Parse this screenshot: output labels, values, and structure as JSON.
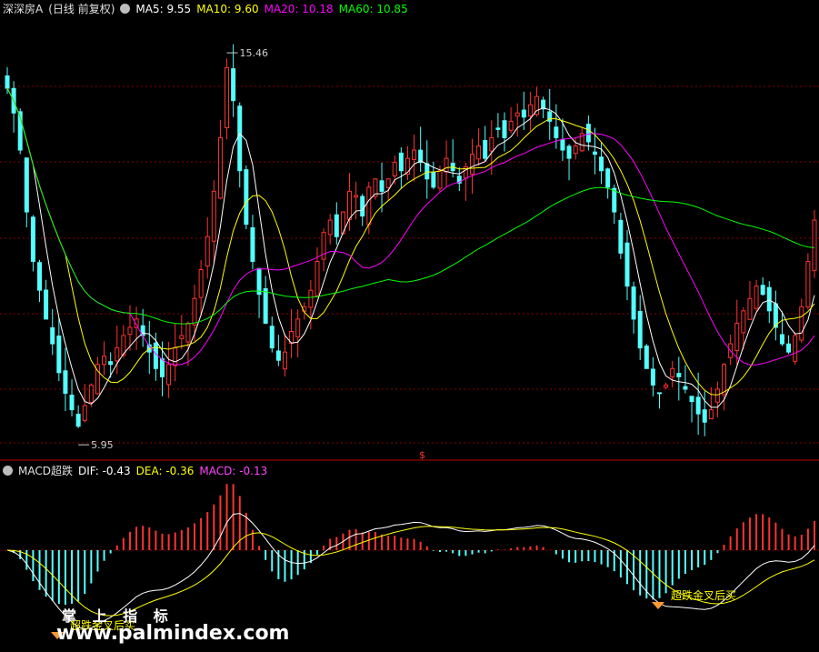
{
  "header": {
    "stock": "深深房A",
    "period": "(日线 前复权)",
    "ma": [
      {
        "label": "MA5: 9.55",
        "color": "#ffffff"
      },
      {
        "label": "MA10: 9.60",
        "color": "#ffff00"
      },
      {
        "label": "MA20: 10.18",
        "color": "#ff00ff"
      },
      {
        "label": "MA60: 10.85",
        "color": "#00ff00"
      }
    ]
  },
  "macd_header": {
    "name": "MACD超跌",
    "dif": "DIF: -0.43",
    "dea": "DEA: -0.36",
    "macd": "MACD: -0.13"
  },
  "annotations": {
    "high_label": "15.46",
    "low_label": "5.95",
    "signal_left": "超跌金叉后买",
    "signal_right": "超跌金叉后买",
    "marker": "$"
  },
  "watermark": {
    "top": "掌 上 指 标",
    "bottom": "www.palmindex.com"
  },
  "colors": {
    "up": "#ff3232",
    "down": "#54ffff",
    "ma5": "#ffffff",
    "ma10": "#ffff00",
    "ma20": "#ff00ff",
    "ma60": "#00ff00",
    "grid": "#8b0000",
    "signal": "#ffff00",
    "marker": "#ff9933"
  },
  "chart_data": [
    {
      "type": "candlestick",
      "title": "深深房A (日线 前复权)",
      "ylim": [
        5.6,
        16.3
      ],
      "annotations": {
        "high": 15.46,
        "low": 5.95
      },
      "ma_latest": {
        "MA5": 9.55,
        "MA10": 9.6,
        "MA20": 10.18,
        "MA60": 10.85
      },
      "close_approx": [
        14.6,
        14.0,
        13.1,
        11.6,
        10.4,
        9.7,
        9.0,
        8.4,
        7.7,
        7.2,
        6.8,
        6.4,
        6.9,
        7.4,
        7.9,
        8.1,
        7.9,
        8.3,
        8.6,
        8.8,
        9.0,
        8.6,
        8.2,
        7.8,
        7.6,
        7.9,
        8.3,
        8.6,
        8.9,
        9.5,
        10.2,
        11.0,
        12.1,
        13.4,
        15.1,
        14.3,
        12.6,
        11.3,
        10.4,
        9.6,
        8.9,
        8.3,
        8.0,
        8.2,
        8.7,
        9.0,
        9.3,
        9.7,
        10.4,
        11.1,
        11.4,
        11.0,
        11.6,
        12.1,
        12.0,
        11.5,
        12.2,
        12.4,
        12.1,
        12.4,
        12.8,
        12.6,
        12.9,
        13.1,
        12.8,
        12.4,
        12.2,
        12.6,
        12.9,
        12.6,
        12.3,
        12.7,
        13.0,
        13.2,
        12.9,
        13.4,
        13.6,
        13.4,
        13.8,
        14.0,
        13.9,
        14.2,
        14.4,
        14.1,
        13.8,
        13.4,
        13.1,
        12.9,
        13.2,
        13.5,
        13.3,
        13.0,
        12.6,
        12.2,
        11.6,
        10.6,
        9.8,
        9.0,
        8.3,
        7.8,
        7.4,
        7.2,
        7.4,
        7.8,
        7.6,
        7.3,
        7.0,
        6.7,
        6.5,
        6.8,
        7.3,
        7.9,
        8.4,
        8.9,
        9.2,
        9.5,
        9.8,
        9.6,
        9.2,
        8.8,
        8.4,
        8.2,
        8.6,
        9.3,
        10.4,
        11.4
      ]
    },
    {
      "type": "bar",
      "title": "MACD超跌",
      "series": [
        {
          "name": "DIF",
          "latest": -0.43
        },
        {
          "name": "DEA",
          "latest": -0.36
        },
        {
          "name": "MACD",
          "latest": -0.13
        }
      ]
    }
  ]
}
